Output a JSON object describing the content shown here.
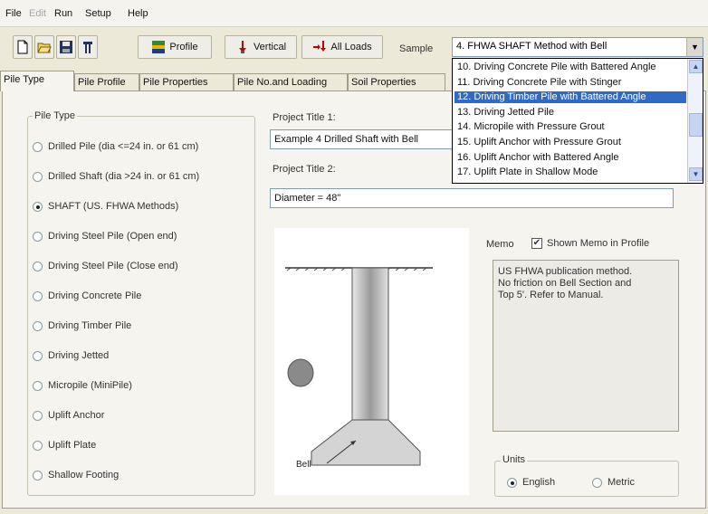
{
  "menu": [
    {
      "label": "File",
      "enabled": true
    },
    {
      "label": "Edit",
      "enabled": false
    },
    {
      "label": "Run",
      "enabled": true
    },
    {
      "label": "Setup",
      "enabled": true
    },
    {
      "label": "Help",
      "enabled": true
    }
  ],
  "toolbar": {
    "profile_label": "Profile",
    "vertical_label": "Vertical",
    "all_loads_label": "All Loads",
    "sample_label": "Sample",
    "sample_value": "4.  FHWA SHAFT Method with Bell"
  },
  "tabs": [
    "Pile Type",
    "Pile Profile",
    "Pile Properties",
    "Pile No.and Loading",
    "Soil Properties"
  ],
  "sample_dropdown": {
    "items": [
      "10. Driving Concrete Pile with Battered Angle",
      "11. Driving Concrete Pile with Stinger",
      "12. Driving Timber Pile with Battered Angle",
      "13. Driving Jetted Pile",
      "14. Micropile with Pressure Grout",
      "15. Uplift Anchor with Pressure Grout",
      "16. Uplift Anchor with Battered Angle",
      "17. Uplift Plate in Shallow Mode"
    ],
    "selected_index": 2
  },
  "pile_type": {
    "title": "Pile Type",
    "options": [
      "Drilled Pile (dia <=24 in. or 61 cm)",
      "Drilled Shaft (dia >24 in. or 61 cm)",
      "SHAFT (US. FHWA Methods)",
      "Driving Steel Pile (Open end)",
      "Driving Steel Pile (Close end)",
      "Driving Concrete Pile",
      "Driving Timber Pile",
      "Driving Jetted",
      "Micropile (MiniPile)",
      "Uplift Anchor",
      "Uplift Plate",
      "Shallow Footing"
    ],
    "selected_index": 2
  },
  "project": {
    "title1_label": "Project Title 1:",
    "title1_value": "Example 4    Drilled Shaft with Bell",
    "title2_label": "Project Title 2:",
    "title2_value": "Diameter = 48\""
  },
  "drawing": {
    "bell_label": "Bell"
  },
  "memo": {
    "label": "Memo",
    "show_label": "Shown Memo in Profile",
    "show_checked": true,
    "text": "US FHWA publication method.\nNo friction on Bell Section and\nTop 5'.  Refer to Manual."
  },
  "units": {
    "title": "Units",
    "options": [
      "English",
      "Metric"
    ],
    "selected_index": 0
  },
  "colors": {
    "selection_blue": "#316ac5",
    "window_bg": "#ece9d8"
  }
}
